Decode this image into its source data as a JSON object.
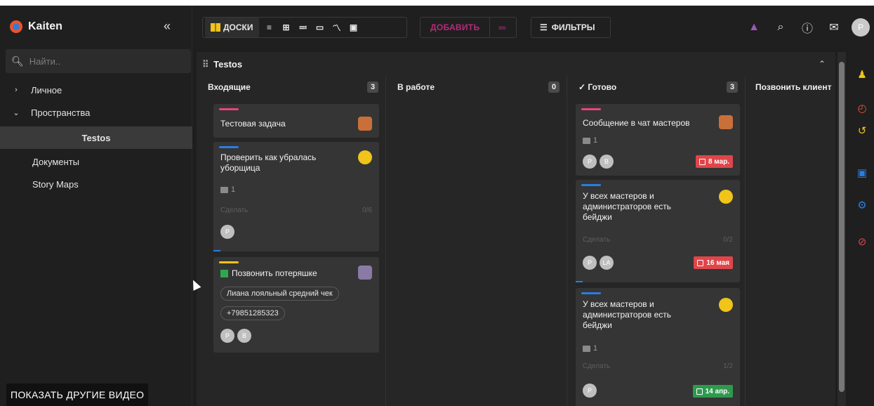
{
  "sidebar": {
    "brand": "Kaiten",
    "collapse_glyph": "«",
    "search_placeholder": "Найти..",
    "items": [
      {
        "label": "Личное",
        "chevron": "›"
      },
      {
        "label": "Пространства",
        "chevron": "⌄"
      },
      {
        "label": "Testos"
      },
      {
        "label": "Документы"
      },
      {
        "label": "Story Maps"
      }
    ],
    "video_label": "ПОКАЗАТЬ ДРУГИЕ ВИДЕО"
  },
  "toolbar": {
    "boards_label": "ДОСКИ",
    "add_label": "ДОБАВИТЬ",
    "add_menu_glyph": "═",
    "filters_label": "ФИЛЬТРЫ",
    "filters_glyph": "☰",
    "view_icons": [
      "≡",
      "⊞",
      "≕",
      "▭",
      "〽",
      "▣"
    ],
    "user_initial": "P"
  },
  "board": {
    "title": "Testos",
    "title_glyph": "⠿",
    "collapse_glyph": "⌃",
    "columns": [
      {
        "title": "Входящие",
        "count": "3"
      },
      {
        "title": "В работе",
        "count": "0"
      },
      {
        "title": "✓ Готово",
        "count": "3"
      },
      {
        "title": "Позвонить клиент"
      }
    ]
  },
  "cards": {
    "c1": {
      "title": "Тестовая задача"
    },
    "c2": {
      "title": "Проверить как убралась уборщица",
      "comments": "1",
      "check_label": "Сделать",
      "check_value": "0/6",
      "avatar": "P"
    },
    "c3": {
      "title": "Позвонить потеряшке",
      "tag1": "Лиана лояльный средний чек",
      "tag2": "+79851285323",
      "avatar1": "P",
      "avatar2": "B"
    },
    "c4": {
      "title": "Сообщение в чат мастеров",
      "comments": "1",
      "avatar1": "P",
      "avatar2": "B",
      "due": "8 мар."
    },
    "c5": {
      "title": "У всех мастеров и администраторов есть бейджи",
      "check_label": "Сделать",
      "check_value": "0/2",
      "avatar1": "P",
      "avatar2": "LA",
      "due": "16 мая"
    },
    "c6": {
      "title": "У всех мастеров и администраторов есть бейджи",
      "comments": "1",
      "check_label": "Сделать",
      "check_value": "1/2",
      "avatar": "P",
      "due": "14 апр."
    }
  },
  "colors": {
    "accent": "#2a7de1",
    "pink": "#e8457a",
    "yellow": "#f0c419",
    "due_red": "#e0454a",
    "due_green": "#2e9a4e",
    "add_button": "#b52b7a"
  }
}
